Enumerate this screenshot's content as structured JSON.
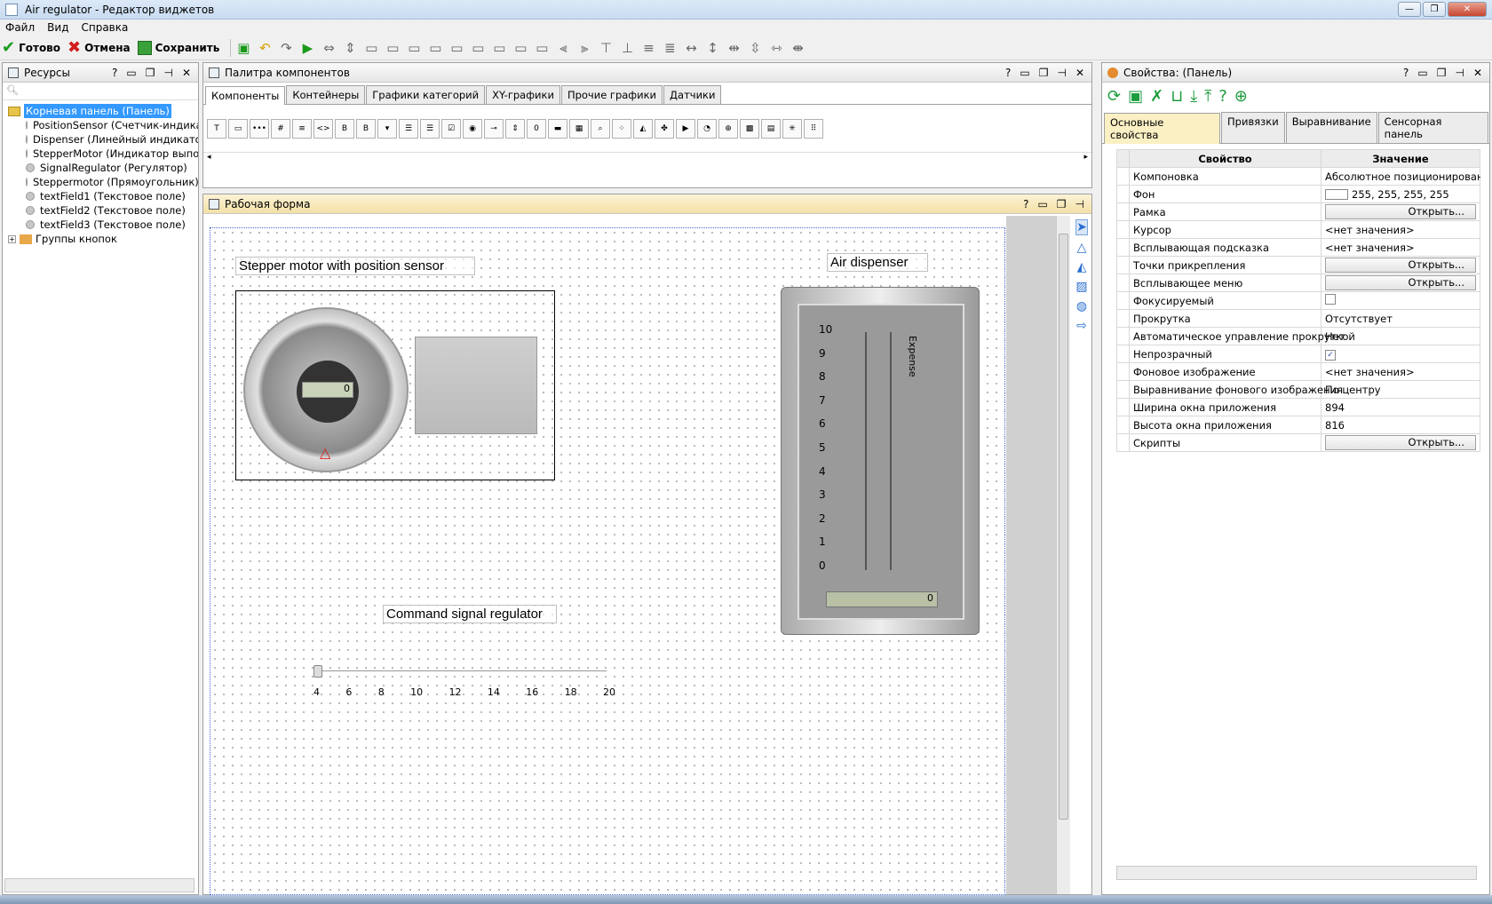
{
  "window": {
    "title": "Air regulator  - Редактор виджетов",
    "min": "—",
    "max": "❐",
    "close": "✕"
  },
  "menu": [
    "Файл",
    "Вид",
    "Справка"
  ],
  "toolbar": {
    "done": "Готово",
    "cancel": "Отмена",
    "save": "Сохранить"
  },
  "resources": {
    "title": "Ресурсы",
    "root": "Корневая панель  (Панель)",
    "items": [
      "PositionSensor  (Счетчик-индикатор)",
      "Dispenser  (Линейный индикатор)",
      "StepperMotor  (Индикатор выполнения)",
      "SignalRegulator  (Регулятор)",
      "Steppermotor  (Прямоугольник)",
      "textField1  (Текстовое поле)",
      "textField2  (Текстовое поле)",
      "textField3  (Текстовое поле)"
    ],
    "group": "Группы кнопок"
  },
  "palette": {
    "title": "Палитра компонентов",
    "tabs": [
      "Компоненты",
      "Контейнеры",
      "Графики категорий",
      "XY-графики",
      "Прочие графики",
      "Датчики"
    ]
  },
  "workform": {
    "title": "Рабочая форма",
    "label1": "Stepper motor with position sensor",
    "label2": "Air dispenser",
    "label3": "Command signal regulator",
    "dispenser_axis": "Expense",
    "dispenser_ticks": [
      "10",
      "9",
      "8",
      "7",
      "6",
      "5",
      "4",
      "3",
      "2",
      "1",
      "0"
    ],
    "slider_ticks": [
      "4",
      "6",
      "8",
      "10",
      "12",
      "14",
      "16",
      "18",
      "20"
    ],
    "lcd_value": "0"
  },
  "properties": {
    "title": "Свойства:  (Панель)",
    "tabs": [
      "Основные свойства",
      "Привязки",
      "Выравнивание",
      "Сенсорная панель"
    ],
    "col_prop": "Свойство",
    "col_value": "Значение",
    "rows": [
      {
        "name": "Компоновка",
        "value": "Абсолютное позиционирование"
      },
      {
        "name": "Фон",
        "value": "255, 255, 255, 255"
      },
      {
        "name": "Рамка",
        "value": "Открыть..."
      },
      {
        "name": "Курсор",
        "value": "<нет значения>"
      },
      {
        "name": "Всплывающая подсказка",
        "value": "<нет значения>"
      },
      {
        "name": "Точки прикрепления",
        "value": "Открыть..."
      },
      {
        "name": "Всплывающее меню",
        "value": "Открыть..."
      },
      {
        "name": "Фокусируемый",
        "value": ""
      },
      {
        "name": "Прокрутка",
        "value": "Отсутствует"
      },
      {
        "name": "Автоматическое управление прокруткой",
        "value": "Нет"
      },
      {
        "name": "Непрозрачный",
        "value": "✓"
      },
      {
        "name": "Фоновое изображение",
        "value": "<нет значения>"
      },
      {
        "name": "Выравнивание фонового изображения",
        "value": "По центру"
      },
      {
        "name": "Ширина окна приложения",
        "value": "894"
      },
      {
        "name": "Высота окна приложения",
        "value": "816"
      },
      {
        "name": "Скрипты",
        "value": "Открыть..."
      }
    ]
  }
}
